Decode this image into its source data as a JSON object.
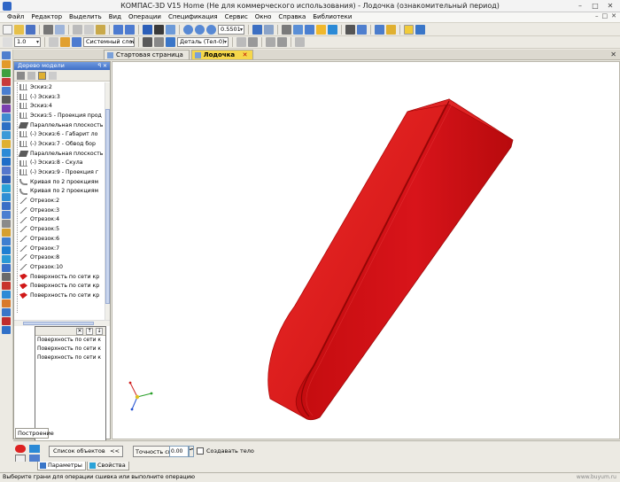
{
  "window": {
    "title": "КОМПАС-3D V15 Home (Не для коммерческого использования) - Лодочка (ознакомительный период)",
    "min": "–",
    "max": "□",
    "close": "✕"
  },
  "menu": {
    "items": [
      "Файл",
      "Редактор",
      "Выделить",
      "Вид",
      "Операции",
      "Спецификация",
      "Сервис",
      "Окно",
      "Справка",
      "Библиотеки"
    ],
    "mdi": [
      "–",
      "□",
      "✕"
    ]
  },
  "toolbar1": {
    "zoom_value": "0.5501"
  },
  "toolbar2": {
    "scale_value": "1.0",
    "layer_value": "Системный слой (0)",
    "part_value": "Деталь (Тел-0)"
  },
  "doctabs": {
    "tabs": [
      {
        "label": "Стартовая страница"
      },
      {
        "label": "Лодочка"
      }
    ],
    "tab_close": "✕",
    "panel_close": "✕"
  },
  "tree_panel": {
    "header": "Дерево модели",
    "header_buttons": "ꟼ ✕",
    "items": [
      {
        "label": "Эскиз:2",
        "icon": "sketch",
        "color": "#6b6b6b"
      },
      {
        "label": "(-) Эскиз:3",
        "icon": "sketch",
        "color": "#6b6b6b"
      },
      {
        "label": "Эскиз:4",
        "icon": "sketch",
        "color": "#6b6b6b"
      },
      {
        "label": "Эскиз:5 - Проекция прод",
        "icon": "sketch",
        "color": "#6b6b6b"
      },
      {
        "label": "Параллельная плоскость",
        "icon": "plane",
        "color": "#5a5a5a"
      },
      {
        "label": "(-) Эскиз:6 - Габарит ло",
        "icon": "sketch",
        "color": "#6b6b6b"
      },
      {
        "label": "(-) Эскиз:7 - Обвод бор",
        "icon": "sketch",
        "color": "#6b6b6b"
      },
      {
        "label": "Параллельная плоскость",
        "icon": "plane",
        "color": "#5a5a5a"
      },
      {
        "label": "(-) Эскиз:8 - Скула",
        "icon": "sketch",
        "color": "#6b6b6b"
      },
      {
        "label": "(-) Эскиз:9 - Проекция г",
        "icon": "sketch",
        "color": "#6b6b6b"
      },
      {
        "label": "Кривая по 2 проекциям",
        "icon": "curve",
        "color": "#8a8a8a"
      },
      {
        "label": "Кривая по 2 проекциям",
        "icon": "curve",
        "color": "#8a8a8a"
      },
      {
        "label": "Отрезок:2",
        "icon": "segment",
        "color": "#777777"
      },
      {
        "label": "Отрезок:3",
        "icon": "segment",
        "color": "#777777"
      },
      {
        "label": "Отрезок:4",
        "icon": "segment",
        "color": "#777777"
      },
      {
        "label": "Отрезок:5",
        "icon": "segment",
        "color": "#777777"
      },
      {
        "label": "Отрезок:6",
        "icon": "segment",
        "color": "#777777"
      },
      {
        "label": "Отрезок:7",
        "icon": "segment",
        "color": "#777777"
      },
      {
        "label": "Отрезок:8",
        "icon": "segment",
        "color": "#777777"
      },
      {
        "label": "Отрезок:10",
        "icon": "segment",
        "color": "#777777"
      },
      {
        "label": "Поверхность по сети кр",
        "icon": "surface",
        "color": "#d01818"
      },
      {
        "label": "Поверхность по сети кр",
        "icon": "surface",
        "color": "#d01818"
      },
      {
        "label": "Поверхность по сети кр",
        "icon": "surface",
        "color": "#d01818"
      }
    ]
  },
  "object_list_panel": {
    "buttons": [
      "✕",
      "↑",
      "↓"
    ],
    "rows": [
      "Поверхность по сети к",
      "Поверхность по сети к",
      "Поверхность по сети к"
    ]
  },
  "sub_tab": {
    "label": "Построение"
  },
  "prop_bar": {
    "object_list_label": "Список объектов",
    "object_list_chevron": "<<",
    "accuracy_label": "Точность сшивки",
    "accuracy_value": "0.00",
    "spin": "▴▾",
    "create_body_label": "Создавать тело",
    "create_body_checked": false
  },
  "bottom_tabs": [
    {
      "label": "Параметры"
    },
    {
      "label": "Свойства"
    }
  ],
  "status": {
    "text": "Выберите грани для операции сшивка или выполните операцию",
    "watermark": "www.buyum.ru"
  },
  "colors": {
    "model_red": "#d60f12",
    "model_dark": "#a8080a",
    "panel_blue": "#3f6fc6",
    "active_tab": "#f6d74a"
  }
}
